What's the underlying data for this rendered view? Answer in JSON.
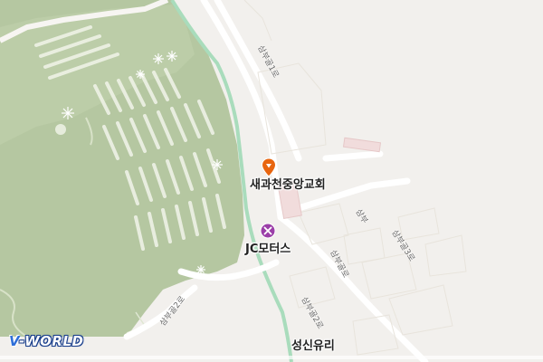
{
  "map": {
    "provider_logo": {
      "prefix": "V",
      "name": "-WORLD"
    },
    "places": [
      {
        "name": "새과천중앙교회",
        "icon": "location-pin-icon",
        "color": "#e8650f"
      },
      {
        "name": "JC모터스",
        "icon": "car-repair-icon",
        "color": "#9b3fa8"
      },
      {
        "name": "성신유리"
      }
    ],
    "roads": [
      {
        "name": "삼부골1로"
      },
      {
        "name": "삼부"
      },
      {
        "name": "삼부골3로"
      },
      {
        "name": "삼부골로"
      },
      {
        "name": "삼부골2로"
      },
      {
        "name": "삼부골2로"
      }
    ],
    "colors": {
      "park": "#b7c8a3",
      "land": "#f2f0ed",
      "stream": "#a8d8b8",
      "road": "#ffffff"
    }
  }
}
